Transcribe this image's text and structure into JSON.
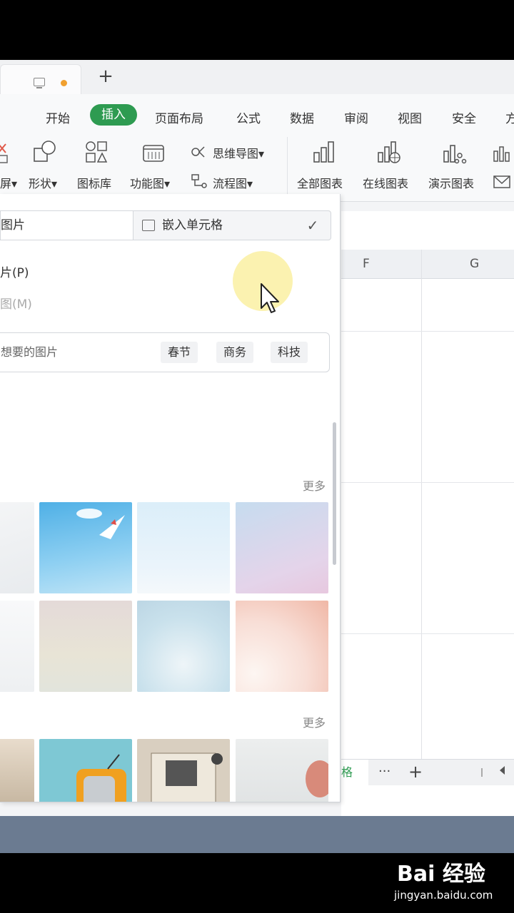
{
  "tabbar": {
    "new_tab_label": "+"
  },
  "menu": {
    "items": [
      "开始",
      "插入",
      "页面布局",
      "公式",
      "数据",
      "审阅",
      "视图",
      "安全",
      "方"
    ],
    "active": "插入"
  },
  "ribbon": {
    "screen_label": "屏",
    "shape_label": "形状",
    "iconlib_label": "图标库",
    "funcchart_label": "功能图",
    "mindmap_label": "思维导图",
    "flowchart_label": "流程图",
    "allcharts_label": "全部图表",
    "onlinecharts_label": "在线图表",
    "democharts_label": "演示图表"
  },
  "panel": {
    "mode_left": "图片",
    "mode_right": "嵌入单元格",
    "option1": "片(P)",
    "option2": "图(M)",
    "search_placeholder": "想要的图片",
    "tags": [
      "春节",
      "商务",
      "科技"
    ],
    "more1": "更多",
    "more2": "更多"
  },
  "sheet": {
    "col_f": "F",
    "col_g": "G",
    "sheet_tab_fragment": "格",
    "sheetbar_more": "···",
    "sheetbar_add": "+"
  },
  "watermark": {
    "logo_text": "Bai 经验",
    "url": "jingyan.baidu.com"
  }
}
